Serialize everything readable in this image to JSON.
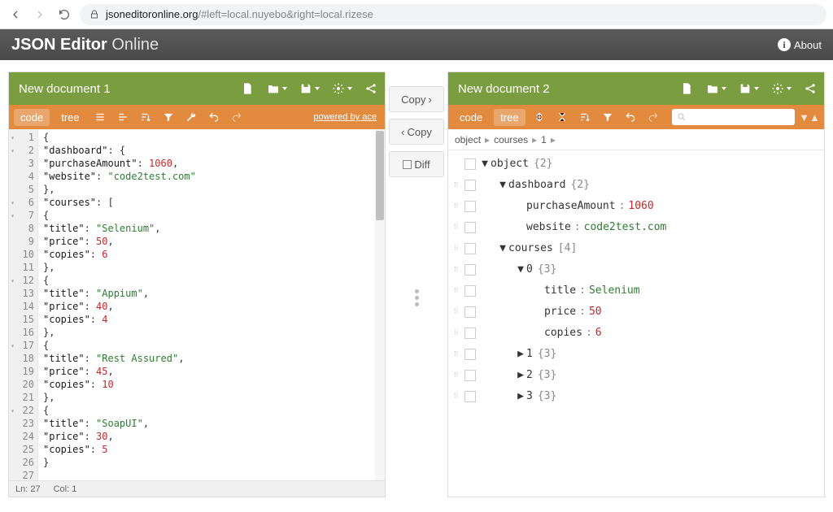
{
  "browser": {
    "url_secure": "jsoneditoronline.org",
    "url_path": "/#left=local.nuyebo&right=local.rizese"
  },
  "app": {
    "title_bold": "JSON Editor",
    "title_thin": " Online",
    "about": "About"
  },
  "left": {
    "title": "New document 1",
    "modes": {
      "code": "code",
      "tree": "tree"
    },
    "powered": "powered by ace",
    "status": {
      "ln_label": "Ln:",
      "ln": "27",
      "col_label": "Col:",
      "col": "1"
    },
    "lines": [
      {
        "n": 1,
        "fold": true,
        "t": [
          {
            "c": "k-pun",
            "s": "{"
          }
        ]
      },
      {
        "n": 2,
        "fold": true,
        "t": [
          {
            "c": "k-key",
            "s": "\"dashboard\""
          },
          {
            "c": "k-pun",
            "s": ": {"
          }
        ]
      },
      {
        "n": 3,
        "t": [
          {
            "c": "k-key",
            "s": "\"purchaseAmount\""
          },
          {
            "c": "k-pun",
            "s": ": "
          },
          {
            "c": "k-num",
            "s": "1060"
          },
          {
            "c": "k-pun",
            "s": ","
          }
        ]
      },
      {
        "n": 4,
        "t": [
          {
            "c": "k-key",
            "s": "\"website\""
          },
          {
            "c": "k-pun",
            "s": ": "
          },
          {
            "c": "k-str",
            "s": "\"code2test.com\""
          }
        ]
      },
      {
        "n": 5,
        "t": [
          {
            "c": "k-pun",
            "s": "},"
          }
        ]
      },
      {
        "n": 6,
        "fold": true,
        "t": [
          {
            "c": "k-key",
            "s": "\"courses\""
          },
          {
            "c": "k-pun",
            "s": ": ["
          }
        ]
      },
      {
        "n": 7,
        "fold": true,
        "t": [
          {
            "c": "k-pun",
            "s": "{"
          }
        ]
      },
      {
        "n": 8,
        "t": [
          {
            "c": "k-key",
            "s": "\"title\""
          },
          {
            "c": "k-pun",
            "s": ": "
          },
          {
            "c": "k-str",
            "s": "\"Selenium\""
          },
          {
            "c": "k-pun",
            "s": ","
          }
        ]
      },
      {
        "n": 9,
        "t": [
          {
            "c": "k-key",
            "s": "\"price\""
          },
          {
            "c": "k-pun",
            "s": ": "
          },
          {
            "c": "k-num",
            "s": "50"
          },
          {
            "c": "k-pun",
            "s": ","
          }
        ]
      },
      {
        "n": 10,
        "t": [
          {
            "c": "k-key",
            "s": "\"copies\""
          },
          {
            "c": "k-pun",
            "s": ": "
          },
          {
            "c": "k-num",
            "s": "6"
          }
        ]
      },
      {
        "n": 11,
        "t": [
          {
            "c": "k-pun",
            "s": "},"
          }
        ]
      },
      {
        "n": 12,
        "fold": true,
        "t": [
          {
            "c": "k-pun",
            "s": "{"
          }
        ]
      },
      {
        "n": 13,
        "t": [
          {
            "c": "k-key",
            "s": "\"title\""
          },
          {
            "c": "k-pun",
            "s": ": "
          },
          {
            "c": "k-str",
            "s": "\"Appium\""
          },
          {
            "c": "k-pun",
            "s": ","
          }
        ]
      },
      {
        "n": 14,
        "t": [
          {
            "c": "k-key",
            "s": "\"price\""
          },
          {
            "c": "k-pun",
            "s": ": "
          },
          {
            "c": "k-num",
            "s": "40"
          },
          {
            "c": "k-pun",
            "s": ","
          }
        ]
      },
      {
        "n": 15,
        "t": [
          {
            "c": "k-key",
            "s": "\"copies\""
          },
          {
            "c": "k-pun",
            "s": ": "
          },
          {
            "c": "k-num",
            "s": "4"
          }
        ]
      },
      {
        "n": 16,
        "t": [
          {
            "c": "k-pun",
            "s": "},"
          }
        ]
      },
      {
        "n": 17,
        "fold": true,
        "t": [
          {
            "c": "k-pun",
            "s": "{"
          }
        ]
      },
      {
        "n": 18,
        "t": [
          {
            "c": "k-key",
            "s": "\"title\""
          },
          {
            "c": "k-pun",
            "s": ": "
          },
          {
            "c": "k-str",
            "s": "\"Rest Assured\""
          },
          {
            "c": "k-pun",
            "s": ","
          }
        ]
      },
      {
        "n": 19,
        "t": [
          {
            "c": "k-key",
            "s": "\"price\""
          },
          {
            "c": "k-pun",
            "s": ": "
          },
          {
            "c": "k-num",
            "s": "45"
          },
          {
            "c": "k-pun",
            "s": ","
          }
        ]
      },
      {
        "n": 20,
        "t": [
          {
            "c": "k-key",
            "s": "\"copies\""
          },
          {
            "c": "k-pun",
            "s": ": "
          },
          {
            "c": "k-num",
            "s": "10"
          }
        ]
      },
      {
        "n": 21,
        "t": [
          {
            "c": "k-pun",
            "s": "},"
          }
        ]
      },
      {
        "n": 22,
        "fold": true,
        "t": [
          {
            "c": "k-pun",
            "s": "{"
          }
        ]
      },
      {
        "n": 23,
        "t": [
          {
            "c": "k-key",
            "s": "\"title\""
          },
          {
            "c": "k-pun",
            "s": ": "
          },
          {
            "c": "k-str",
            "s": "\"SoapUI\""
          },
          {
            "c": "k-pun",
            "s": ","
          }
        ]
      },
      {
        "n": 24,
        "t": [
          {
            "c": "k-key",
            "s": "\"price\""
          },
          {
            "c": "k-pun",
            "s": ": "
          },
          {
            "c": "k-num",
            "s": "30"
          },
          {
            "c": "k-pun",
            "s": ","
          }
        ]
      },
      {
        "n": 25,
        "t": [
          {
            "c": "k-key",
            "s": "\"copies\""
          },
          {
            "c": "k-pun",
            "s": ": "
          },
          {
            "c": "k-num",
            "s": "5"
          }
        ]
      },
      {
        "n": 26,
        "t": [
          {
            "c": "k-pun",
            "s": "}"
          }
        ]
      },
      {
        "n": 27,
        "hl": true,
        "t": [
          {
            "c": "k-pun",
            "s": ""
          }
        ]
      }
    ]
  },
  "mid": {
    "copy_right": "Copy",
    "copy_left": "Copy",
    "diff": "Diff"
  },
  "right": {
    "title": "New document 2",
    "modes": {
      "code": "code",
      "tree": "tree"
    },
    "crumb": [
      "object",
      "courses",
      "1"
    ],
    "rows": [
      {
        "d": 0,
        "grip": false,
        "exp": "▼",
        "key": "object",
        "meta": "{2}"
      },
      {
        "d": 1,
        "exp": "▼",
        "key": "dashboard",
        "meta": "{2}"
      },
      {
        "d": 2,
        "key": "purchaseAmount",
        "val": "1060",
        "vt": "num"
      },
      {
        "d": 2,
        "key": "website",
        "val": "code2test.com",
        "vt": "str"
      },
      {
        "d": 1,
        "exp": "▼",
        "key": "courses",
        "meta": "[4]"
      },
      {
        "d": 2,
        "exp": "▼",
        "key": "0",
        "meta": "{3}"
      },
      {
        "d": 3,
        "key": "title",
        "val": "Selenium",
        "vt": "str"
      },
      {
        "d": 3,
        "key": "price",
        "val": "50",
        "vt": "num"
      },
      {
        "d": 3,
        "key": "copies",
        "val": "6",
        "vt": "num"
      },
      {
        "d": 2,
        "exp": "▶",
        "key": "1",
        "meta": "{3}"
      },
      {
        "d": 2,
        "exp": "▶",
        "key": "2",
        "meta": "{3}"
      },
      {
        "d": 2,
        "exp": "▶",
        "key": "3",
        "meta": "{3}"
      }
    ]
  }
}
